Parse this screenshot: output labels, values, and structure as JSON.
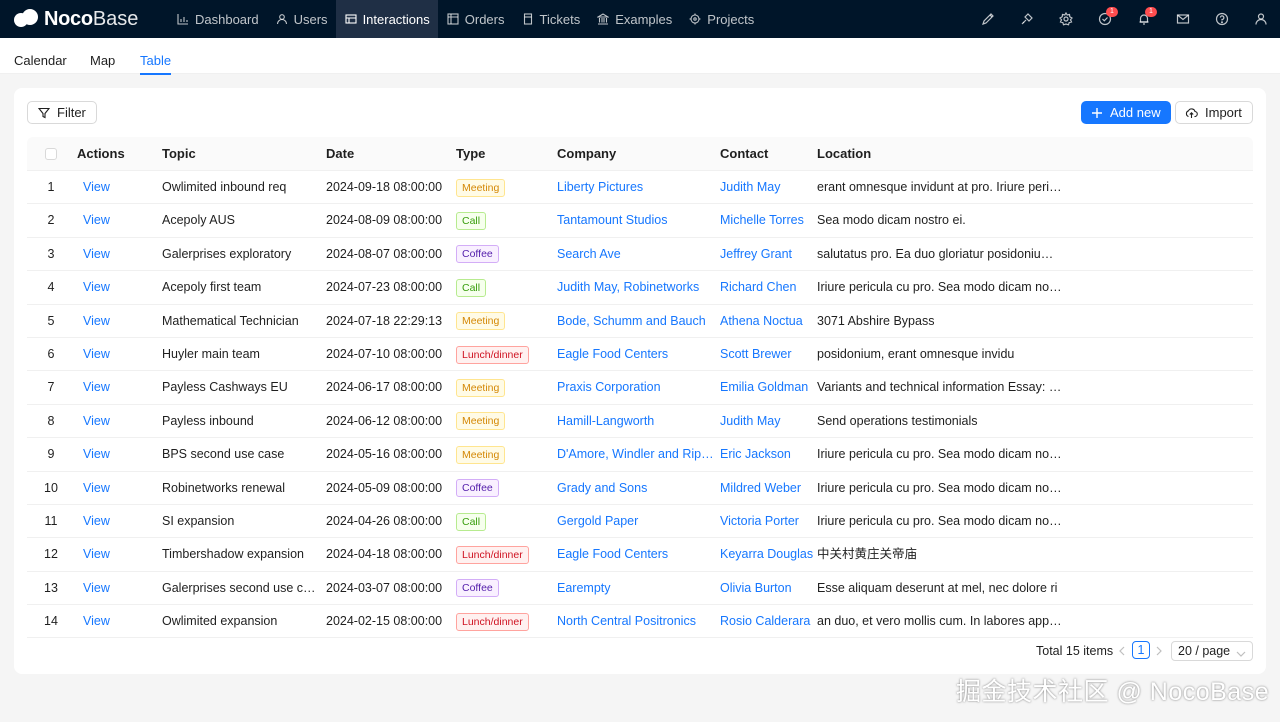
{
  "brand": {
    "noco": "Noco",
    "base": "Base"
  },
  "nav": [
    {
      "label": "Dashboard",
      "icon": "chart-icon",
      "active": false
    },
    {
      "label": "Users",
      "icon": "user-icon",
      "active": false
    },
    {
      "label": "Interactions",
      "icon": "table-icon",
      "active": true
    },
    {
      "label": "Orders",
      "icon": "grid-icon",
      "active": false
    },
    {
      "label": "Tickets",
      "icon": "ticket-icon",
      "active": false
    },
    {
      "label": "Examples",
      "icon": "bank-icon",
      "active": false
    },
    {
      "label": "Projects",
      "icon": "target-icon",
      "active": false
    }
  ],
  "topbar_icons": {
    "badge_tasks": "1",
    "badge_notifications": "1"
  },
  "tabs": [
    "Calendar",
    "Map",
    "Table"
  ],
  "active_tab": "Table",
  "toolbar": {
    "filter": "Filter",
    "add_new": "Add new",
    "import": "Import"
  },
  "columns": [
    "Actions",
    "Topic",
    "Date",
    "Type",
    "Company",
    "Contact",
    "Location"
  ],
  "rows": [
    {
      "n": "1",
      "action": "View",
      "topic": "Owlimited inbound req",
      "date": "2024-09-18 08:00:00",
      "type": "Meeting",
      "company": "Liberty Pictures",
      "contact": "Judith May",
      "location": "erant omnesque invidunt at pro. Iriure pericula"
    },
    {
      "n": "2",
      "action": "View",
      "topic": "Acepoly AUS",
      "date": "2024-08-09 08:00:00",
      "type": "Call",
      "company": "Tantamount Studios",
      "contact": "Michelle Torres",
      "location": "Sea modo dicam nostro ei."
    },
    {
      "n": "3",
      "action": "View",
      "topic": "Galerprises exploratory",
      "date": "2024-08-07 08:00:00",
      "type": "Coffee",
      "company": "Search Ave",
      "contact": "Jeffrey Grant",
      "location": "salutatus pro. Ea duo gloriatur posidonium, erant"
    },
    {
      "n": "4",
      "action": "View",
      "topic": "Acepoly first team",
      "date": "2024-07-23 08:00:00",
      "type": "Call",
      "company": "Judith May, Robinetworks",
      "contact": "Richard Chen",
      "location": "Iriure pericula cu pro. Sea modo dicam nostro ei."
    },
    {
      "n": "5",
      "action": "View",
      "topic": "Mathematical Technician",
      "date": "2024-07-18 22:29:13",
      "type": "Meeting",
      "company": "Bode, Schumm and Bauch",
      "contact": "Athena Noctua",
      "location": "3071 Abshire Bypass"
    },
    {
      "n": "6",
      "action": "View",
      "topic": "Huyler main team",
      "date": "2024-07-10 08:00:00",
      "type": "Lunch/dinner",
      "company": "Eagle Food Centers",
      "contact": "Scott Brewer",
      "location": "posidonium, erant omnesque invidu"
    },
    {
      "n": "7",
      "action": "View",
      "topic": "Payless Cashways EU",
      "date": "2024-06-17 08:00:00",
      "type": "Meeting",
      "company": "Praxis Corporation",
      "contact": "Emilia Goldman",
      "location": "Variants and technical information Essay: Lorem"
    },
    {
      "n": "8",
      "action": "View",
      "topic": "Payless inbound",
      "date": "2024-06-12 08:00:00",
      "type": "Meeting",
      "company": "Hamill-Langworth",
      "contact": "Judith May",
      "location": "Send operations testimonials"
    },
    {
      "n": "9",
      "action": "View",
      "topic": "BPS second use case",
      "date": "2024-05-16 08:00:00",
      "type": "Meeting",
      "company": "D'Amore, Windler and Rippin",
      "contact": "Eric Jackson",
      "location": "Iriure pericula cu pro. Sea modo dicam nostro ei."
    },
    {
      "n": "10",
      "action": "View",
      "topic": "Robinetworks renewal",
      "date": "2024-05-09 08:00:00",
      "type": "Coffee",
      "company": "Grady and Sons",
      "contact": "Mildred Weber",
      "location": "Iriure pericula cu pro. Sea modo dicam nostro ei."
    },
    {
      "n": "11",
      "action": "View",
      "topic": "SI expansion",
      "date": "2024-04-26 08:00:00",
      "type": "Call",
      "company": "Gergold Paper",
      "contact": "Victoria Porter",
      "location": "Iriure pericula cu pro. Sea modo dicam nostro ei."
    },
    {
      "n": "12",
      "action": "View",
      "topic": "Timbershadow expansion",
      "date": "2024-04-18 08:00:00",
      "type": "Lunch/dinner",
      "company": "Eagle Food Centers",
      "contact": "Keyarra Douglas",
      "location": "中关村黄庄关帝庙"
    },
    {
      "n": "13",
      "action": "View",
      "topic": "Galerprises second use case",
      "date": "2024-03-07 08:00:00",
      "type": "Coffee",
      "company": "Earempty",
      "contact": "Olivia Burton",
      "location": "Esse aliquam deserunt at mel, nec dolore ri"
    },
    {
      "n": "14",
      "action": "View",
      "topic": "Owlimited expansion",
      "date": "2024-02-15 08:00:00",
      "type": "Lunch/dinner",
      "company": "North Central Positronics",
      "contact": "Rosio Calderara",
      "location": "an duo, et vero mollis cum. In labores apparea"
    }
  ],
  "pagination": {
    "total": "Total 15 items",
    "page": "1",
    "page_size": "20 / page"
  },
  "watermark": "掘金技术社区 @ NocoBase",
  "colors": {
    "accent": "#1677ff",
    "header_bg": "#001529"
  }
}
